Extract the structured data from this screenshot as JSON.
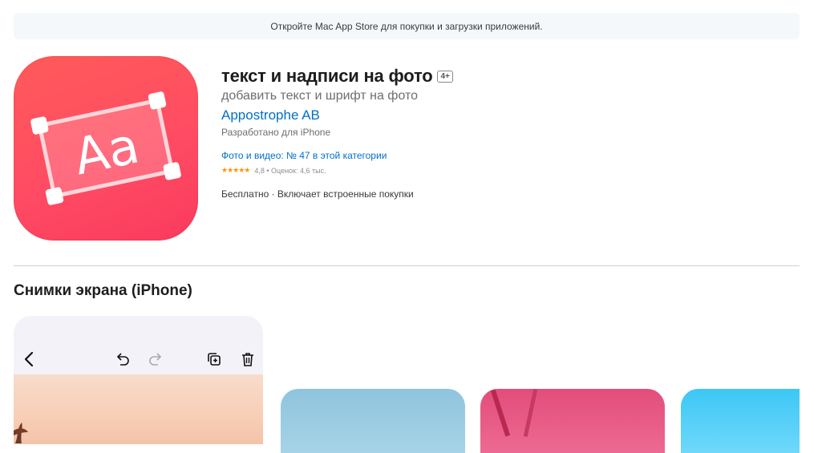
{
  "banner": {
    "text": "Откройте Mac App Store для покупки и загрузки приложений."
  },
  "app": {
    "title": "текст и надписи на фото",
    "age_rating": "4+",
    "subtitle": "добавить текст и шрифт на фото",
    "developer": "Appostrophe AB",
    "designed_for": "Разработано для iPhone",
    "rank": "Фото и видео: № 47 в этой категории",
    "stars": "★★★★★",
    "rating": "4,8",
    "rating_count": "Оценок: 4,6 тыс.",
    "price": "Бесплатно · Включает встроенные покупки",
    "icon_text": "Aa"
  },
  "screenshots": {
    "title": "Снимки экрана (iPhone)"
  },
  "colors": {
    "link": "#0070c9",
    "icon_red": "#ff4c63",
    "star": "#ff9500"
  }
}
